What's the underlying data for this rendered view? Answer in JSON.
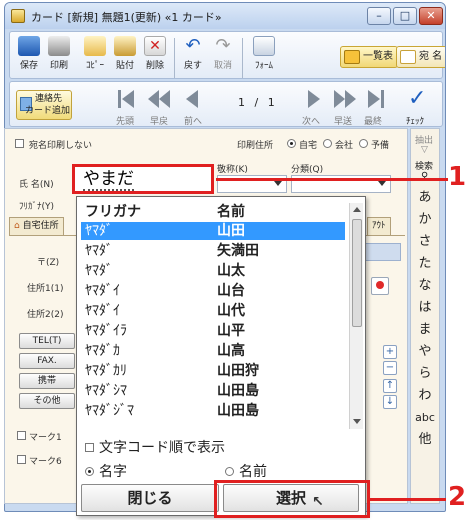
{
  "window": {
    "title": "カード  [新規] 無題1(更新)    «1 カード»",
    "min": "–",
    "max": "□",
    "close": "✕"
  },
  "toolbar": {
    "buttons": [
      "保存",
      "印刷",
      "ｺﾋﾟｰ",
      "貼付",
      "削除",
      "戻す",
      "取消",
      "ﾌｫｰﾑ"
    ],
    "list_button": "一覧表",
    "name_button": "宛 名"
  },
  "nav": {
    "add_contact": "連絡先\nカード追加",
    "add_contact_line1": "連絡先",
    "add_contact_line2": "カード追加",
    "first": "先頭",
    "fast_back": "早戻",
    "prev": "前へ",
    "page_current": "1",
    "page_sep": "/",
    "page_total": "1",
    "next": "次へ",
    "fast_fwd": "早送",
    "last": "最終",
    "check": "ﾁｪｯｸ"
  },
  "form": {
    "no_print_label": "宛名印刷しない",
    "print_address_label": "印刷住所",
    "print_opts": [
      "自宅",
      "会社",
      "予備"
    ],
    "name_label": "氏 名(N)",
    "furigana_label": "ﾌﾘｶﾞﾅ(Y)",
    "title_label": "敬称(K)",
    "category_label": "分類(Q)",
    "name_value": "やまだ",
    "home_tab": "自宅住所",
    "layout_tab": "ｱｳﾄ",
    "zip_label": "〒(Z)",
    "addr1_label": "住所1(1)",
    "addr2_label": "住所2(2)",
    "tel_button": "TEL(T)",
    "fax_button": "FAX.",
    "mobile_button": "携帯",
    "other_button": "その他",
    "mark1": "マーク1",
    "mark6": "マーク6"
  },
  "index": {
    "extract": "抽出",
    "search": "検索",
    "kana": [
      "あ",
      "か",
      "さ",
      "た",
      "な",
      "は",
      "ま",
      "や",
      "ら",
      "わ"
    ],
    "abc": "abc",
    "other": "他"
  },
  "popup": {
    "col_furigana": "フリガナ",
    "col_name": "名前",
    "rows": [
      {
        "furigana": "ﾔﾏﾀﾞ",
        "name": "山田"
      },
      {
        "furigana": "ﾔﾏﾀﾞ",
        "name": "矢満田"
      },
      {
        "furigana": "ﾔﾏﾀﾞ",
        "name": "山太"
      },
      {
        "furigana": "ﾔﾏﾀﾞｲ",
        "name": "山台"
      },
      {
        "furigana": "ﾔﾏﾀﾞｲ",
        "name": "山代"
      },
      {
        "furigana": "ﾔﾏﾀﾞｲﾗ",
        "name": "山平"
      },
      {
        "furigana": "ﾔﾏﾀﾞｶ",
        "name": "山高"
      },
      {
        "furigana": "ﾔﾏﾀﾞｶﾘ",
        "name": "山田狩"
      },
      {
        "furigana": "ﾔﾏﾀﾞｼﾏ",
        "name": "山田島"
      },
      {
        "furigana": "ﾔﾏﾀﾞｼﾞﾏ",
        "name": "山田島"
      }
    ],
    "sort_by_code": "文字コード順で表示",
    "opt_name": "名字",
    "opt_given": "名前",
    "close_button": "閉じる",
    "select_button": "選択"
  },
  "callouts": {
    "first": "1",
    "second": "2"
  }
}
